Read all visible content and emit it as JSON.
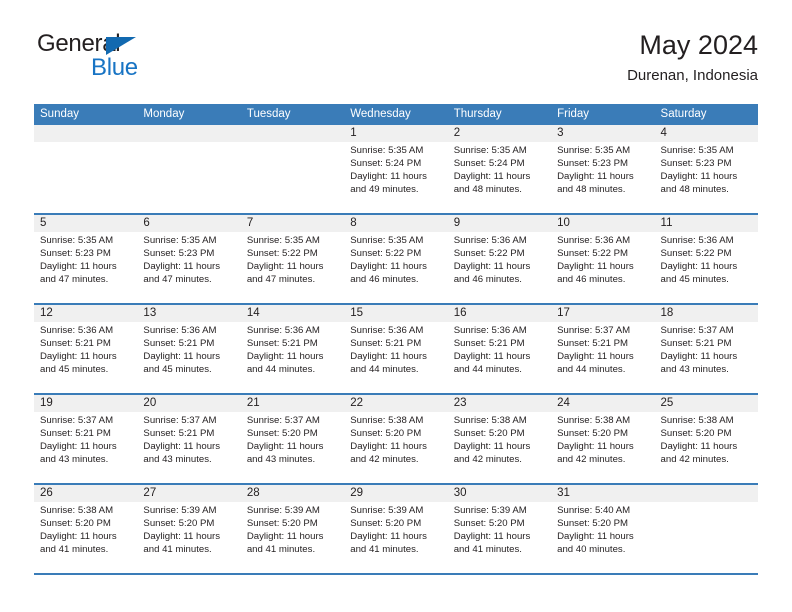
{
  "brand": {
    "name_part1": "General",
    "name_part2": "Blue"
  },
  "header": {
    "title": "May 2024",
    "subtitle": "Durenan, Indonesia"
  },
  "colors": {
    "header_blue": "#3a7cb8",
    "brand_blue": "#1874c4",
    "daynum_strip": "#f0f0f0",
    "text": "#231f20"
  },
  "weekday_headers": [
    "Sunday",
    "Monday",
    "Tuesday",
    "Wednesday",
    "Thursday",
    "Friday",
    "Saturday"
  ],
  "weeks": [
    [
      {
        "day": "",
        "sunrise": "",
        "sunset": "",
        "daylight": "",
        "empty": true
      },
      {
        "day": "",
        "sunrise": "",
        "sunset": "",
        "daylight": "",
        "empty": true
      },
      {
        "day": "",
        "sunrise": "",
        "sunset": "",
        "daylight": "",
        "empty": true
      },
      {
        "day": "1",
        "sunrise": "Sunrise: 5:35 AM",
        "sunset": "Sunset: 5:24 PM",
        "daylight": "Daylight: 11 hours and 49 minutes.",
        "empty": false
      },
      {
        "day": "2",
        "sunrise": "Sunrise: 5:35 AM",
        "sunset": "Sunset: 5:24 PM",
        "daylight": "Daylight: 11 hours and 48 minutes.",
        "empty": false
      },
      {
        "day": "3",
        "sunrise": "Sunrise: 5:35 AM",
        "sunset": "Sunset: 5:23 PM",
        "daylight": "Daylight: 11 hours and 48 minutes.",
        "empty": false
      },
      {
        "day": "4",
        "sunrise": "Sunrise: 5:35 AM",
        "sunset": "Sunset: 5:23 PM",
        "daylight": "Daylight: 11 hours and 48 minutes.",
        "empty": false
      }
    ],
    [
      {
        "day": "5",
        "sunrise": "Sunrise: 5:35 AM",
        "sunset": "Sunset: 5:23 PM",
        "daylight": "Daylight: 11 hours and 47 minutes.",
        "empty": false
      },
      {
        "day": "6",
        "sunrise": "Sunrise: 5:35 AM",
        "sunset": "Sunset: 5:23 PM",
        "daylight": "Daylight: 11 hours and 47 minutes.",
        "empty": false
      },
      {
        "day": "7",
        "sunrise": "Sunrise: 5:35 AM",
        "sunset": "Sunset: 5:22 PM",
        "daylight": "Daylight: 11 hours and 47 minutes.",
        "empty": false
      },
      {
        "day": "8",
        "sunrise": "Sunrise: 5:35 AM",
        "sunset": "Sunset: 5:22 PM",
        "daylight": "Daylight: 11 hours and 46 minutes.",
        "empty": false
      },
      {
        "day": "9",
        "sunrise": "Sunrise: 5:36 AM",
        "sunset": "Sunset: 5:22 PM",
        "daylight": "Daylight: 11 hours and 46 minutes.",
        "empty": false
      },
      {
        "day": "10",
        "sunrise": "Sunrise: 5:36 AM",
        "sunset": "Sunset: 5:22 PM",
        "daylight": "Daylight: 11 hours and 46 minutes.",
        "empty": false
      },
      {
        "day": "11",
        "sunrise": "Sunrise: 5:36 AM",
        "sunset": "Sunset: 5:22 PM",
        "daylight": "Daylight: 11 hours and 45 minutes.",
        "empty": false
      }
    ],
    [
      {
        "day": "12",
        "sunrise": "Sunrise: 5:36 AM",
        "sunset": "Sunset: 5:21 PM",
        "daylight": "Daylight: 11 hours and 45 minutes.",
        "empty": false
      },
      {
        "day": "13",
        "sunrise": "Sunrise: 5:36 AM",
        "sunset": "Sunset: 5:21 PM",
        "daylight": "Daylight: 11 hours and 45 minutes.",
        "empty": false
      },
      {
        "day": "14",
        "sunrise": "Sunrise: 5:36 AM",
        "sunset": "Sunset: 5:21 PM",
        "daylight": "Daylight: 11 hours and 44 minutes.",
        "empty": false
      },
      {
        "day": "15",
        "sunrise": "Sunrise: 5:36 AM",
        "sunset": "Sunset: 5:21 PM",
        "daylight": "Daylight: 11 hours and 44 minutes.",
        "empty": false
      },
      {
        "day": "16",
        "sunrise": "Sunrise: 5:36 AM",
        "sunset": "Sunset: 5:21 PM",
        "daylight": "Daylight: 11 hours and 44 minutes.",
        "empty": false
      },
      {
        "day": "17",
        "sunrise": "Sunrise: 5:37 AM",
        "sunset": "Sunset: 5:21 PM",
        "daylight": "Daylight: 11 hours and 44 minutes.",
        "empty": false
      },
      {
        "day": "18",
        "sunrise": "Sunrise: 5:37 AM",
        "sunset": "Sunset: 5:21 PM",
        "daylight": "Daylight: 11 hours and 43 minutes.",
        "empty": false
      }
    ],
    [
      {
        "day": "19",
        "sunrise": "Sunrise: 5:37 AM",
        "sunset": "Sunset: 5:21 PM",
        "daylight": "Daylight: 11 hours and 43 minutes.",
        "empty": false
      },
      {
        "day": "20",
        "sunrise": "Sunrise: 5:37 AM",
        "sunset": "Sunset: 5:21 PM",
        "daylight": "Daylight: 11 hours and 43 minutes.",
        "empty": false
      },
      {
        "day": "21",
        "sunrise": "Sunrise: 5:37 AM",
        "sunset": "Sunset: 5:20 PM",
        "daylight": "Daylight: 11 hours and 43 minutes.",
        "empty": false
      },
      {
        "day": "22",
        "sunrise": "Sunrise: 5:38 AM",
        "sunset": "Sunset: 5:20 PM",
        "daylight": "Daylight: 11 hours and 42 minutes.",
        "empty": false
      },
      {
        "day": "23",
        "sunrise": "Sunrise: 5:38 AM",
        "sunset": "Sunset: 5:20 PM",
        "daylight": "Daylight: 11 hours and 42 minutes.",
        "empty": false
      },
      {
        "day": "24",
        "sunrise": "Sunrise: 5:38 AM",
        "sunset": "Sunset: 5:20 PM",
        "daylight": "Daylight: 11 hours and 42 minutes.",
        "empty": false
      },
      {
        "day": "25",
        "sunrise": "Sunrise: 5:38 AM",
        "sunset": "Sunset: 5:20 PM",
        "daylight": "Daylight: 11 hours and 42 minutes.",
        "empty": false
      }
    ],
    [
      {
        "day": "26",
        "sunrise": "Sunrise: 5:38 AM",
        "sunset": "Sunset: 5:20 PM",
        "daylight": "Daylight: 11 hours and 41 minutes.",
        "empty": false
      },
      {
        "day": "27",
        "sunrise": "Sunrise: 5:39 AM",
        "sunset": "Sunset: 5:20 PM",
        "daylight": "Daylight: 11 hours and 41 minutes.",
        "empty": false
      },
      {
        "day": "28",
        "sunrise": "Sunrise: 5:39 AM",
        "sunset": "Sunset: 5:20 PM",
        "daylight": "Daylight: 11 hours and 41 minutes.",
        "empty": false
      },
      {
        "day": "29",
        "sunrise": "Sunrise: 5:39 AM",
        "sunset": "Sunset: 5:20 PM",
        "daylight": "Daylight: 11 hours and 41 minutes.",
        "empty": false
      },
      {
        "day": "30",
        "sunrise": "Sunrise: 5:39 AM",
        "sunset": "Sunset: 5:20 PM",
        "daylight": "Daylight: 11 hours and 41 minutes.",
        "empty": false
      },
      {
        "day": "31",
        "sunrise": "Sunrise: 5:40 AM",
        "sunset": "Sunset: 5:20 PM",
        "daylight": "Daylight: 11 hours and 40 minutes.",
        "empty": false
      },
      {
        "day": "",
        "sunrise": "",
        "sunset": "",
        "daylight": "",
        "empty": true
      }
    ]
  ]
}
